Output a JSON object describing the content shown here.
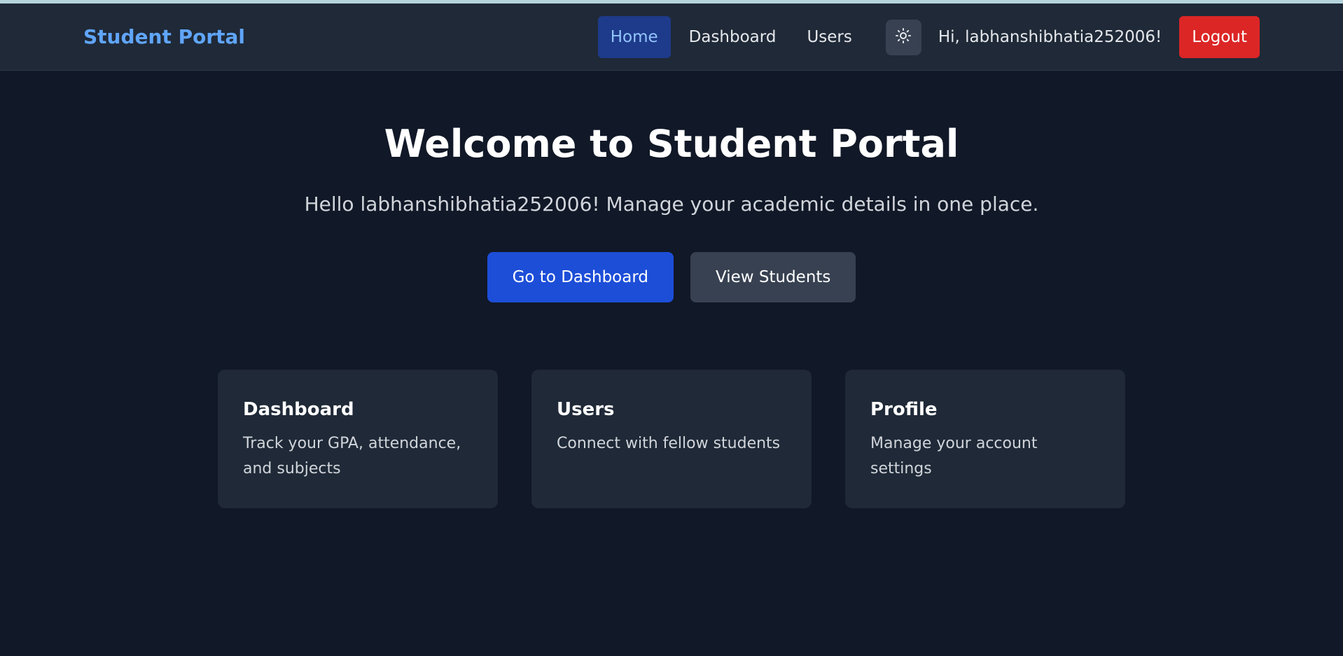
{
  "navbar": {
    "brand": "Student Portal",
    "links": [
      {
        "label": "Home",
        "active": true
      },
      {
        "label": "Dashboard",
        "active": false
      },
      {
        "label": "Users",
        "active": false
      }
    ],
    "theme_toggle_icon": "sun-icon",
    "greeting": "Hi, labhanshibhatia252006!",
    "logout_label": "Logout"
  },
  "hero": {
    "title": "Welcome to Student Portal",
    "subtitle": "Hello labhanshibhatia252006! Manage your academic details in one place.",
    "primary_button": "Go to Dashboard",
    "secondary_button": "View Students"
  },
  "cards": [
    {
      "title": "Dashboard",
      "description": "Track your GPA, attendance, and subjects"
    },
    {
      "title": "Users",
      "description": "Connect with fellow students"
    },
    {
      "title": "Profile",
      "description": "Manage your account settings"
    }
  ],
  "colors": {
    "background": "#111827",
    "navbar": "#1f2937",
    "brand": "#60a5fa",
    "active_nav_bg": "#1e3a8a",
    "primary_button": "#1d4ed8",
    "secondary_button": "#374151",
    "logout": "#dc2626",
    "card": "#1f2937"
  }
}
